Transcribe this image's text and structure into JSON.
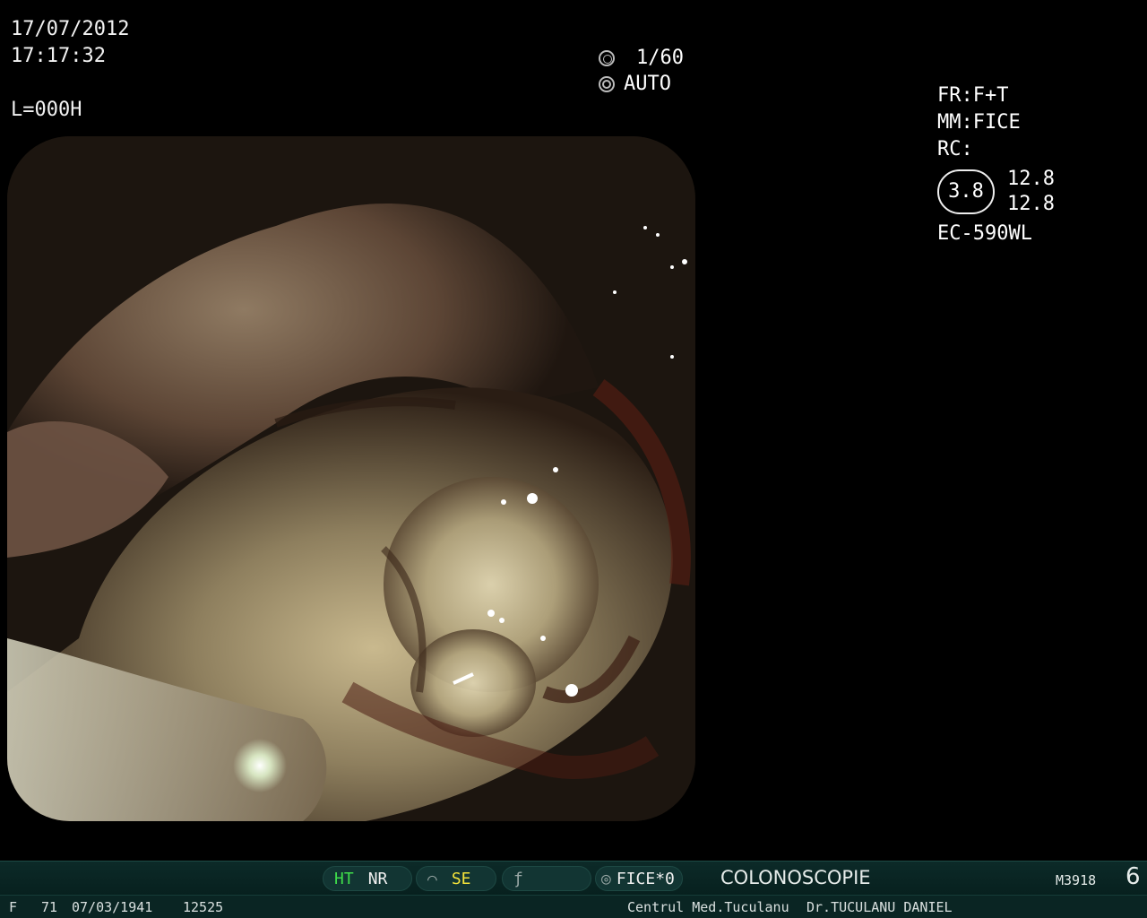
{
  "osd": {
    "date": "17/07/2012",
    "time": "17:17:32",
    "light_level": "L=000H",
    "shutter_speed": "1/60",
    "iris_mode": "AUTO",
    "freeze_mode": "FR:F+T",
    "metering_mode": "MM:FICE",
    "rc": "RC:",
    "ihb_value": "3.8",
    "color_r": "12.8",
    "color_b": "12.8",
    "scope_model": "EC-590WL"
  },
  "status_bar": {
    "ht_label": "HT",
    "nr_label": "NR",
    "se_label": "SE",
    "fice_label": "FICE*0",
    "procedure": "COLONOSCOPIE",
    "memory_id": "M3918",
    "image_count": "6"
  },
  "patient_bar": {
    "sex": "F",
    "age": "71",
    "birth_date": "07/03/1941",
    "patient_id": "12525",
    "clinic": "Centrul Med.Tuculanu",
    "doctor": "Dr.TUCULANU DANIEL"
  },
  "colors": {
    "background": "#000000",
    "status_bar": "#0c2a28",
    "ht_green": "#3fdc4a",
    "se_yellow": "#f3e23a"
  }
}
